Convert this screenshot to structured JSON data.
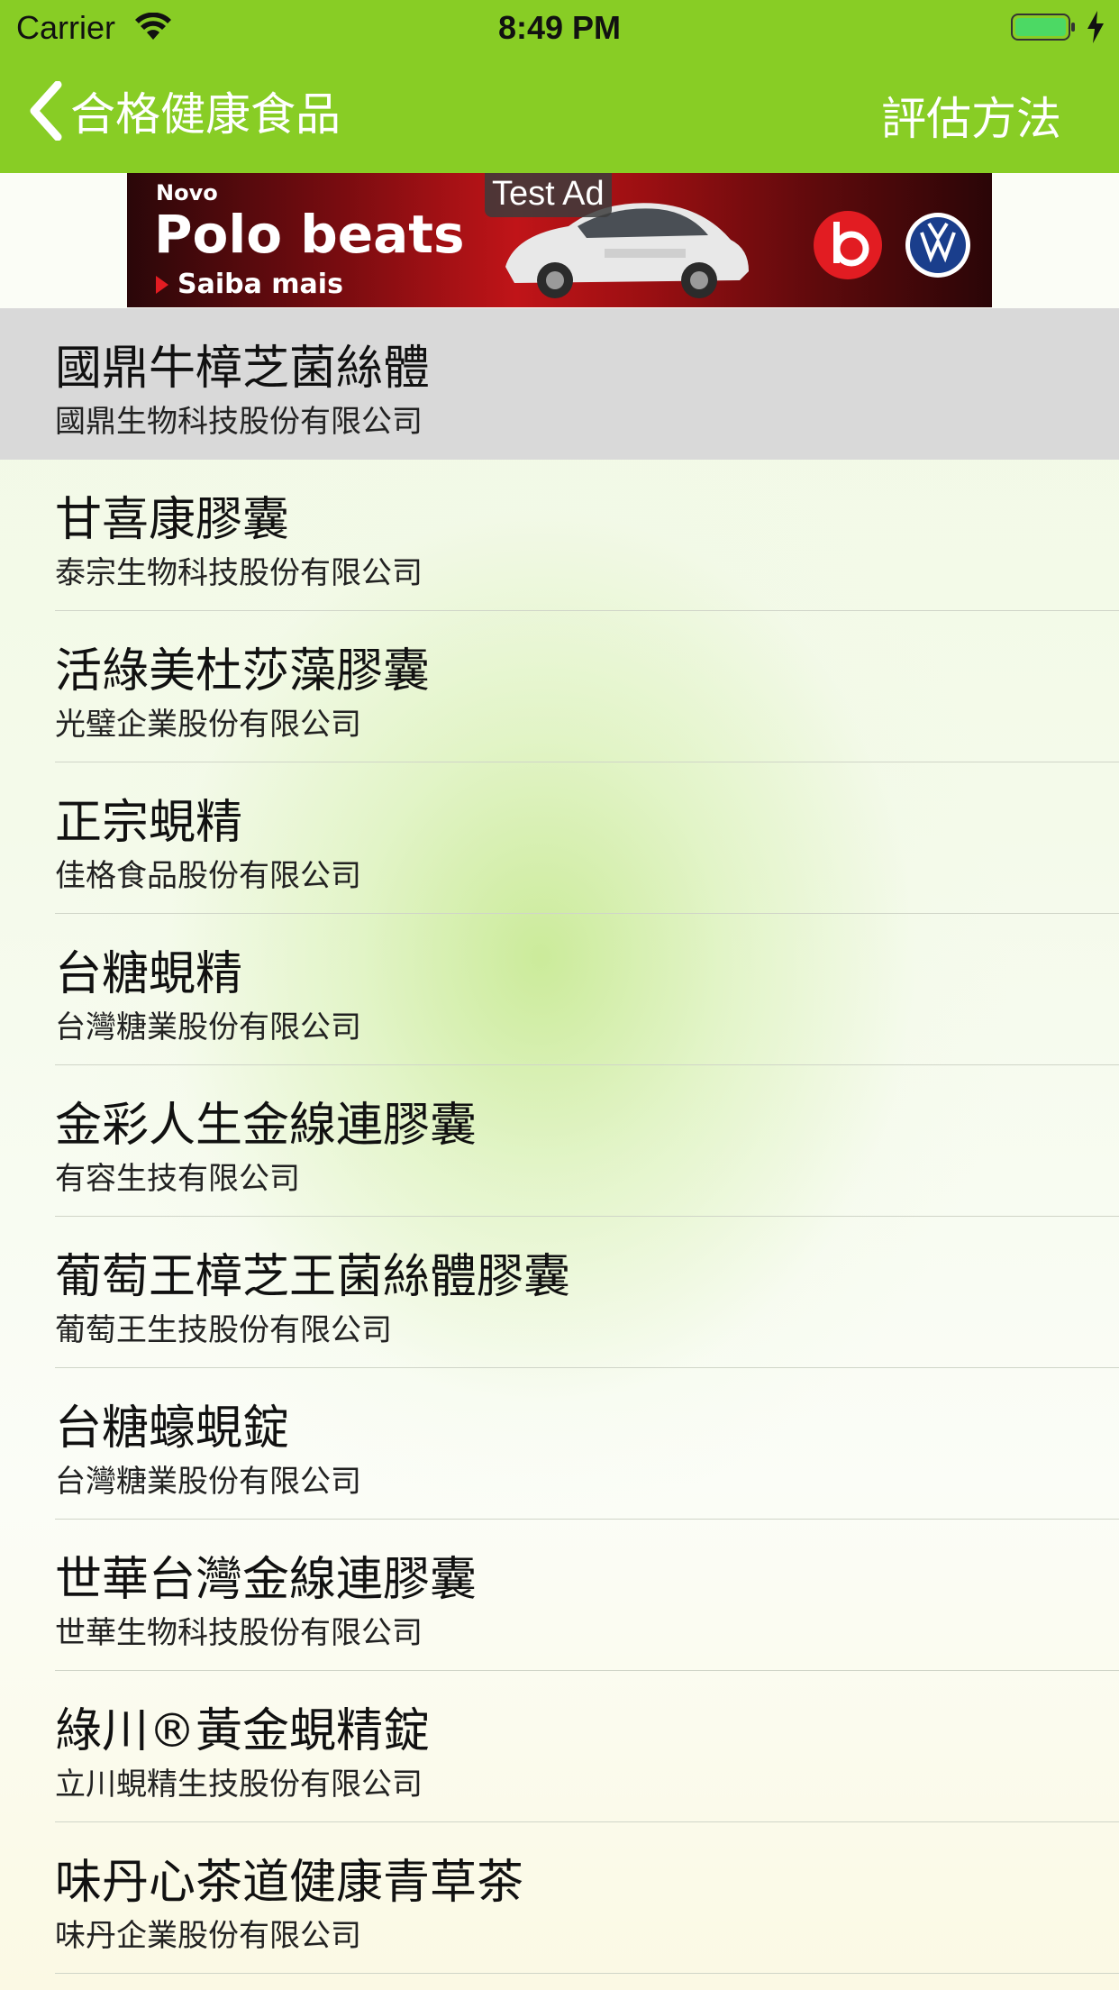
{
  "status_bar": {
    "carrier": "Carrier",
    "time": "8:49 PM",
    "battery_color": "#4cd964"
  },
  "nav": {
    "back_icon": "chevron-left-icon",
    "title": "合格健康食品",
    "right_button": "評估方法",
    "bar_color": "#88cd25"
  },
  "ad": {
    "novo": "Novo",
    "headline": "Polo beats",
    "cta": "Saiba mais",
    "test_label": "Test Ad",
    "info_icon": "info-icon",
    "close_icon": "close-icon"
  },
  "list": {
    "items": [
      {
        "title": "國鼎牛樟芝菌絲體",
        "subtitle": "國鼎生物科技股份有限公司",
        "selected": true
      },
      {
        "title": "甘喜康膠囊",
        "subtitle": "泰宗生物科技股份有限公司"
      },
      {
        "title": "活綠美杜莎藻膠囊",
        "subtitle": "光璧企業股份有限公司"
      },
      {
        "title": "正宗蜆精",
        "subtitle": "佳格食品股份有限公司"
      },
      {
        "title": "台糖蜆精",
        "subtitle": "台灣糖業股份有限公司"
      },
      {
        "title": "金彩人生金線連膠囊",
        "subtitle": "有容生技有限公司"
      },
      {
        "title": "葡萄王樟芝王菌絲體膠囊",
        "subtitle": "葡萄王生技股份有限公司"
      },
      {
        "title": "台糖蠔蜆錠",
        "subtitle": "台灣糖業股份有限公司"
      },
      {
        "title": "世華台灣金線連膠囊",
        "subtitle": "世華生物科技股份有限公司"
      },
      {
        "title": "綠川®黃金蜆精錠",
        "subtitle": "立川蜆精生技股份有限公司"
      },
      {
        "title": "味丹心茶道健康青草茶",
        "subtitle": "味丹企業股份有限公司"
      }
    ]
  }
}
